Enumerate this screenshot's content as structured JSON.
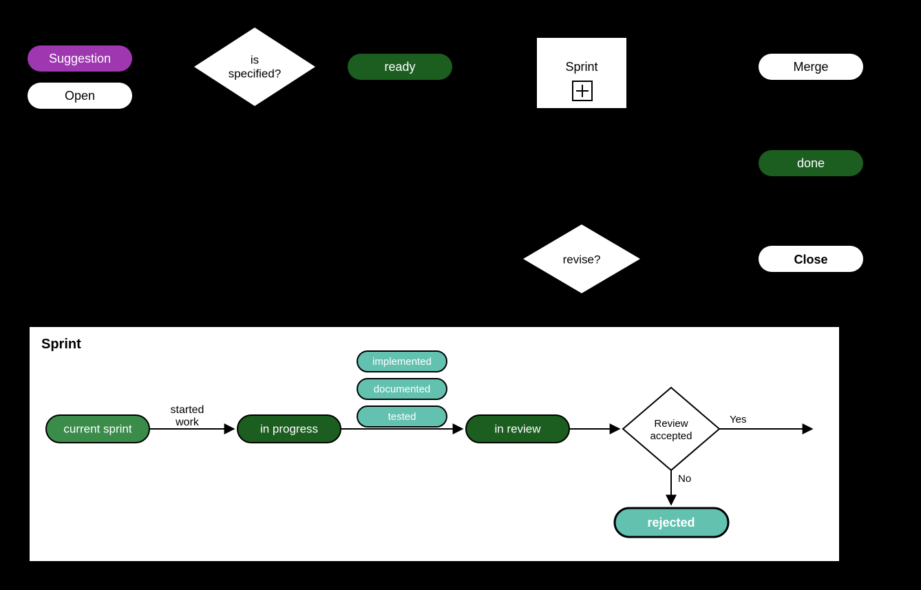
{
  "colors": {
    "purple": "#9E37B0",
    "white": "#FFFFFF",
    "darkGreen": "#1B5E20",
    "lightGreen": "#3B8C4B",
    "teal": "#63C1B0",
    "black": "#000000"
  },
  "nodes": {
    "suggestion": "Suggestion",
    "open": "Open",
    "isSpecified": {
      "line1": "is",
      "line2": "specified?"
    },
    "ready": "ready",
    "sprint": "Sprint",
    "merge": "Merge",
    "done": "done",
    "close": "Close",
    "revise": "revise?"
  },
  "sprintBox": {
    "title": "Sprint",
    "currentSprint": "current sprint",
    "startedWork": {
      "line1": "started",
      "line2": "work"
    },
    "inProgress": "in progress",
    "implemented": "implemented",
    "documented": "documented",
    "tested": "tested",
    "inReview": "in review",
    "reviewAccepted": {
      "line1": "Review",
      "line2": "accepted"
    },
    "yes": "Yes",
    "no": "No",
    "rejected": "rejected"
  }
}
